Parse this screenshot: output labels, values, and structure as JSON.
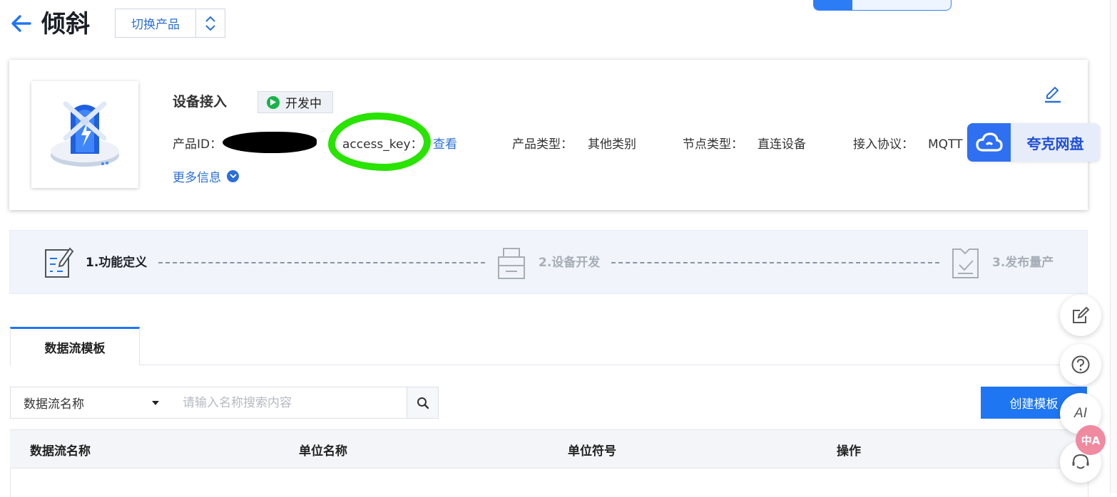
{
  "header": {
    "title": "倾斜",
    "switch_label": "切换产品"
  },
  "product": {
    "name": "设备接入",
    "status": "开发中",
    "id_label": "产品ID：",
    "access_key_label": "access_key：",
    "view_link": "查看",
    "type_label": "产品类型：",
    "type_value": "其他类别",
    "node_label": "节点类型：",
    "node_value": "直连设备",
    "protocol_label": "接入协议：",
    "protocol_value": "MQTT",
    "more_info": "更多信息"
  },
  "quark": {
    "label": "夸克网盘"
  },
  "steps": [
    {
      "label": "1.功能定义",
      "color": "#1e76f2"
    },
    {
      "label": "2.设备开发",
      "color": "#a7adb6"
    },
    {
      "label": "3.发布量产",
      "color": "#a7adb6"
    }
  ],
  "tabs": [
    {
      "label": "数据流模板"
    }
  ],
  "search": {
    "field_select": "数据流名称",
    "placeholder": "请输入名称搜索内容",
    "create_label": "创建模板"
  },
  "table": {
    "columns": [
      "数据流名称",
      "单位名称",
      "单位符号",
      "操作"
    ]
  },
  "float_buttons": {
    "ai_label": "AI",
    "translate_label": "中A"
  },
  "colors": {
    "accent": "#1e76f2",
    "status_green": "#19b34b",
    "highlight": "#29e300"
  },
  "icons": [
    "back-arrow-icon",
    "chevron-updown-icon",
    "play-icon",
    "edit-icon",
    "cloud-icon",
    "search-icon",
    "caret-down-icon",
    "note-icon",
    "help-icon",
    "robot-icon"
  ]
}
